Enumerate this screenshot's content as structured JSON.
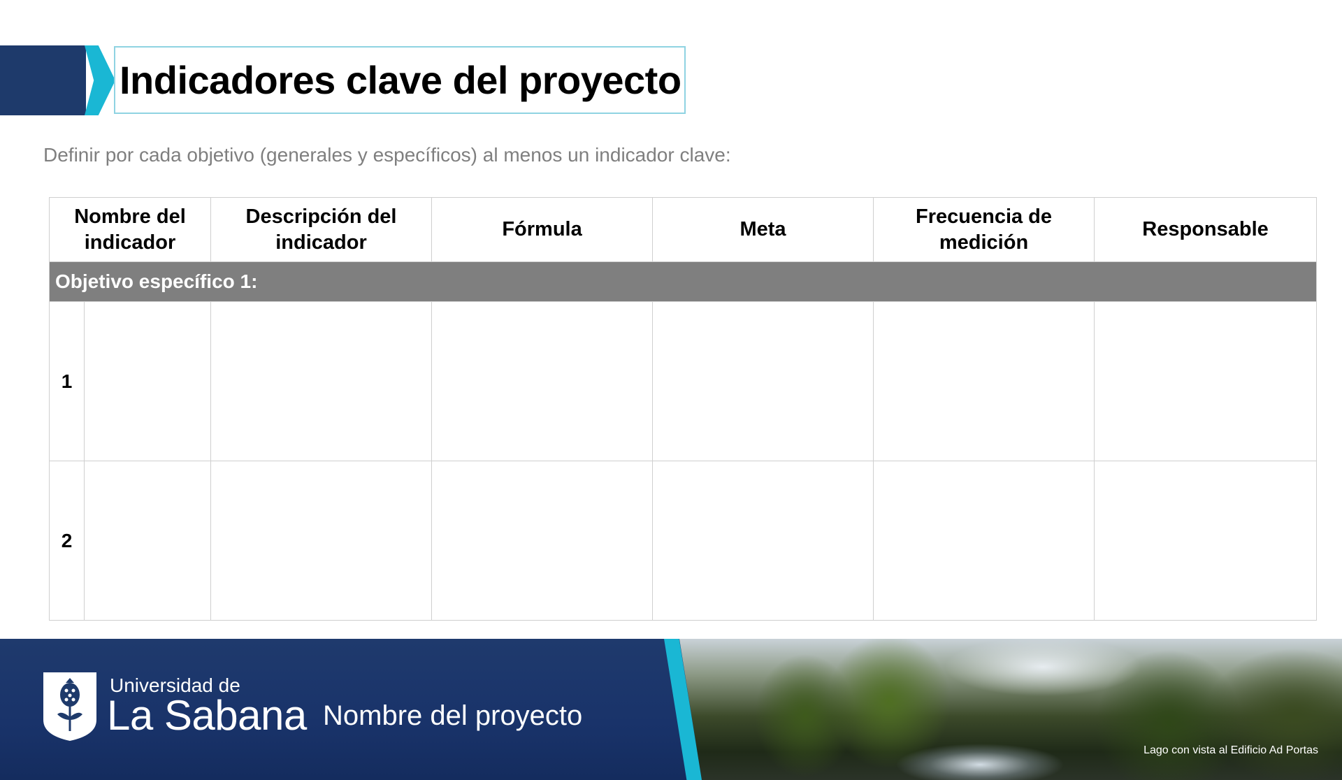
{
  "title": "Indicadores clave del proyecto",
  "subtitle": "Definir por cada objetivo (generales y específicos) al menos un indicador clave:",
  "table": {
    "headers": [
      "Nombre del indicador",
      "Descripción del indicador",
      "Fórmula",
      "Meta",
      "Frecuencia de medición",
      "Responsable"
    ],
    "section_label": "Objetivo específico 1:",
    "rows": [
      {
        "number": "1",
        "cells": [
          "",
          "",
          "",
          "",
          "",
          ""
        ]
      },
      {
        "number": "2",
        "cells": [
          "",
          "",
          "",
          "",
          "",
          ""
        ]
      }
    ]
  },
  "footer": {
    "university_line1": "Universidad de",
    "university_line2": "La Sabana",
    "project_name": "Nombre del proyecto",
    "photo_caption": "Lago con vista al Edificio Ad Portas",
    "logo_icon": "university-shield-icon"
  },
  "colors": {
    "brand_navy": "#1e3a6b",
    "accent_cyan": "#1ab7d4",
    "section_gray": "#7f7f7f"
  }
}
